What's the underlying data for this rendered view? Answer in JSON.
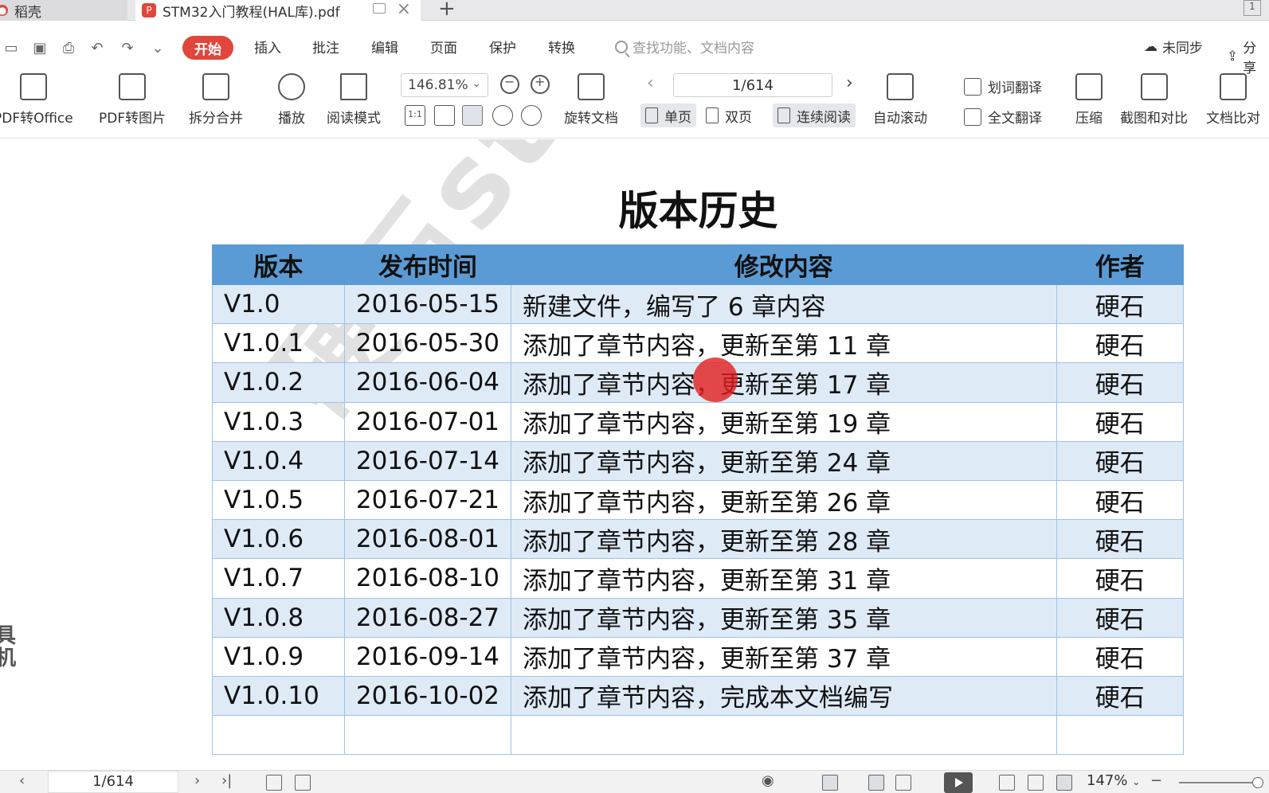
{
  "tabs": {
    "home": "稻壳",
    "document": "STM32入门教程(HAL库).pdf",
    "window_count": "1"
  },
  "menu": {
    "start": "开始",
    "items": [
      "插入",
      "批注",
      "编辑",
      "页面",
      "保护",
      "转换"
    ],
    "search_placeholder": "查找功能、文档内容",
    "sync": "未同步",
    "share": "分享"
  },
  "ribbon": {
    "pdf_to_office": "PDF转Office",
    "pdf_to_image": "PDF转图片",
    "split_merge": "拆分合并",
    "play": "播放",
    "read_mode": "阅读模式",
    "zoom": "146.81%",
    "rotate_doc": "旋转文档",
    "page_indicator": "1/614",
    "single_page": "单页",
    "double_page": "双页",
    "continuous": "连续阅读",
    "auto_scroll": "自动滚动",
    "word_translate": "划词翻译",
    "full_translate": "全文翻译",
    "compress": "压缩",
    "screenshot_compare": "截图和对比",
    "doc_compare": "文档比对"
  },
  "document": {
    "title": "版本历史",
    "watermark": "硬石stm",
    "headers": [
      "版本",
      "发布时间",
      "修改内容",
      "作者"
    ],
    "rows": [
      [
        "V1.0",
        "2016-05-15",
        "新建文件，编写了 6 章内容",
        "硬石"
      ],
      [
        "V1.0.1",
        "2016-05-30",
        "添加了章节内容，更新至第 11 章",
        "硬石"
      ],
      [
        "V1.0.2",
        "2016-06-04",
        "添加了章节内容，更新至第 17 章",
        "硬石"
      ],
      [
        "V1.0.3",
        "2016-07-01",
        "添加了章节内容，更新至第 19 章",
        "硬石"
      ],
      [
        "V1.0.4",
        "2016-07-14",
        "添加了章节内容，更新至第 24 章",
        "硬石"
      ],
      [
        "V1.0.5",
        "2016-07-21",
        "添加了章节内容，更新至第 26 章",
        "硬石"
      ],
      [
        "V1.0.6",
        "2016-08-01",
        "添加了章节内容，更新至第 28 章",
        "硬石"
      ],
      [
        "V1.0.7",
        "2016-08-10",
        "添加了章节内容，更新至第 31 章",
        "硬石"
      ],
      [
        "V1.0.8",
        "2016-08-27",
        "添加了章节内容，更新至第 35 章",
        "硬石"
      ],
      [
        "V1.0.9",
        "2016-09-14",
        "添加了章节内容，更新至第 37 章",
        "硬石"
      ],
      [
        "V1.0.10",
        "2016-10-02",
        "添加了章节内容，完成本文档编写",
        "硬石"
      ],
      [
        "",
        "",
        "",
        ""
      ]
    ],
    "side_sticker": "具\n机"
  },
  "statusbar": {
    "page": "1/614",
    "zoom": "147%"
  },
  "colors": {
    "accent": "#e0463a",
    "table_header": "#5b9bd5",
    "table_stripe": "#deeaf6",
    "table_border": "#9dc3e6"
  }
}
